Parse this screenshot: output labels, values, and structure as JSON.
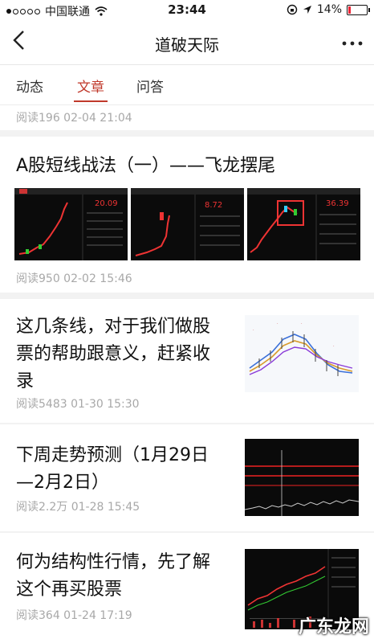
{
  "status_bar": {
    "carrier": "中国联通",
    "time": "23:44",
    "battery": "14%"
  },
  "nav": {
    "back_icon": "chevron-left-icon",
    "title": "道破天际",
    "more_icon": "ellipsis-icon"
  },
  "tabs": [
    {
      "label": "动态",
      "active": false
    },
    {
      "label": "文章",
      "active": true
    },
    {
      "label": "问答",
      "active": false
    }
  ],
  "accent_color": "#c0392b",
  "articles": [
    {
      "title": "",
      "meta": "阅读196   02-04 21:04"
    },
    {
      "title": "A股短线战法（一）——飞龙摆尾",
      "meta": "阅读950   02-02 15:46"
    },
    {
      "title_lines": [
        "这几条线，对于我们做股",
        "票的帮助跟意义，赶紧收",
        "录"
      ],
      "meta": "阅读5483   01-30 15:30"
    },
    {
      "title_lines": [
        "下周走势预测（1月29日",
        "—2月2日）"
      ],
      "meta": "阅读2.2万   01-28 15:45"
    },
    {
      "title_lines": [
        "何为结构性行情，先了解",
        "这个再买股票"
      ],
      "meta": "阅读364   01-24 17:19"
    }
  ],
  "watermark": "广东龙网"
}
